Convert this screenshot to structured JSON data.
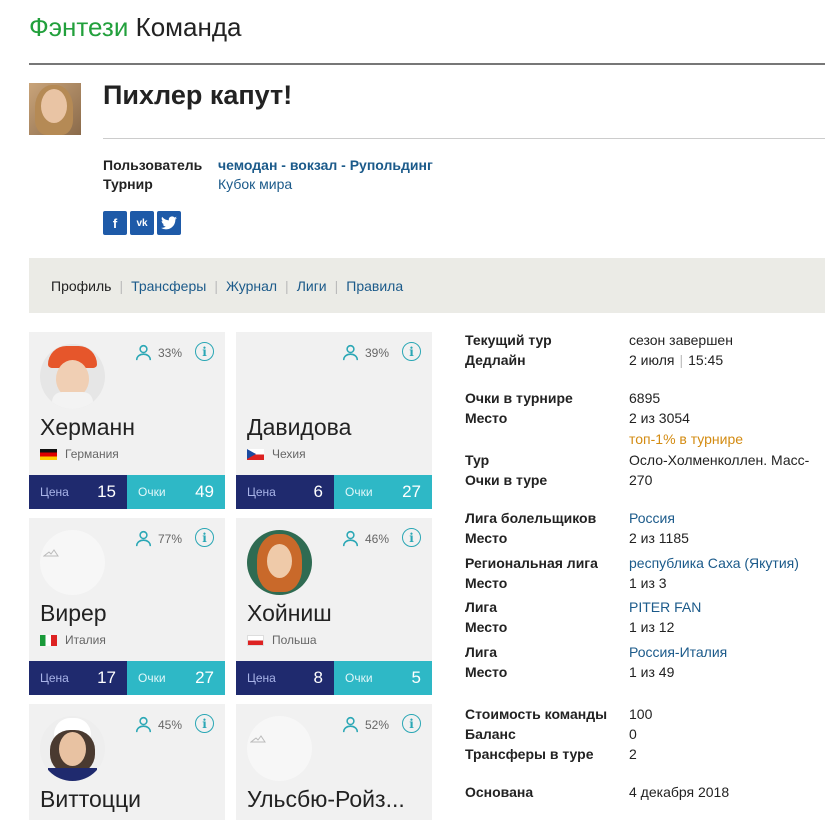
{
  "site": {
    "brand": "Фэнтези",
    "rest": "Команда"
  },
  "team": {
    "name": "Пихлер капут!"
  },
  "meta": {
    "user_label": "Пользователь",
    "user_value": "чемодан - вокзал - Рупольдинг",
    "tournament_label": "Турнир",
    "tournament_value": "Кубок мира"
  },
  "social": [
    "f",
    "vk",
    "t"
  ],
  "nav": {
    "items": [
      "Профиль",
      "Трансферы",
      "Журнал",
      "Лиги",
      "Правила"
    ],
    "active": "Профиль"
  },
  "cards": [
    {
      "name": "Херманн",
      "country": "Германия",
      "owned": "33%",
      "price_label": "Цена",
      "price": "15",
      "points_label": "Очки",
      "points": "49"
    },
    {
      "name": "Давидова",
      "country": "Чехия",
      "owned": "39%",
      "price_label": "Цена",
      "price": "6",
      "points_label": "Очки",
      "points": "27"
    },
    {
      "name": "Вирер",
      "country": "Италия",
      "owned": "77%",
      "price_label": "Цена",
      "price": "17",
      "points_label": "Очки",
      "points": "27"
    },
    {
      "name": "Хойниш",
      "country": "Польша",
      "owned": "46%",
      "price_label": "Цена",
      "price": "8",
      "points_label": "Очки",
      "points": "5"
    },
    {
      "name": "Виттоцци",
      "country": "",
      "owned": "45%"
    },
    {
      "name": "Ульсбю-Ройз...",
      "country": "",
      "owned": "52%"
    }
  ],
  "info_glyph": "i",
  "stats": {
    "current_round_label": "Текущий тур",
    "current_round": "сезон завершен",
    "deadline_label": "Дедлайн",
    "deadline_date": "2 июля",
    "deadline_sep": "|",
    "deadline_time": "15:45",
    "points_label": "Очки в турнире",
    "points": "6895",
    "place_label": "Место",
    "place": "2 из 3054",
    "top_text": "топ-1% в турнире",
    "round_label": "Тур",
    "round": "Осло-Холменколлен. Масс-",
    "round_points_label": "Очки в туре",
    "round_points": "270",
    "fans_league_label": "Лига болельщиков",
    "fans_league": "Россия",
    "fans_place_label": "Место",
    "fans_place": "2 из 1185",
    "regional_label": "Региональная лига",
    "regional": "республика Саха (Якутия)",
    "regional_place_label": "Место",
    "regional_place": "1 из 3",
    "league1_label": "Лига",
    "league1": "PITER FAN",
    "league1_place_label": "Место",
    "league1_place": "1 из 12",
    "league2_label": "Лига",
    "league2": "Россия-Италия",
    "league2_place_label": "Место",
    "league2_place": "1 из 49",
    "cost_label": "Стоимость команды",
    "cost": "100",
    "balance_label": "Баланс",
    "balance": "0",
    "transfers_label": "Трансферы в туре",
    "transfers": "2",
    "founded_label": "Основана",
    "founded": "4 декабря 2018"
  }
}
